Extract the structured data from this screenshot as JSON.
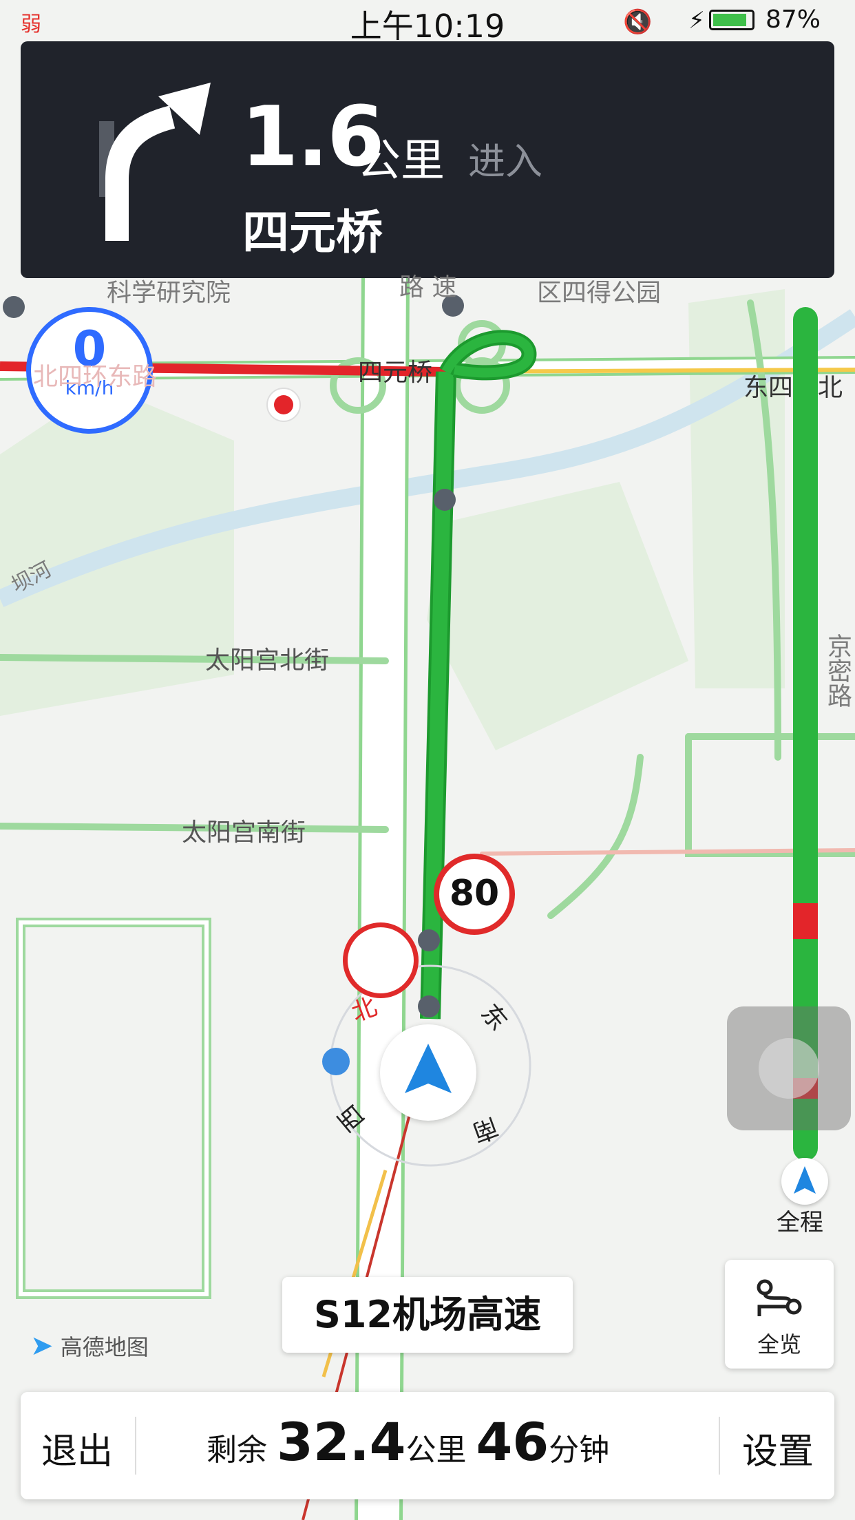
{
  "status_bar": {
    "signal": "弱",
    "time": "上午10:19",
    "battery": "87%"
  },
  "guidance": {
    "turn_icon": "turn-right-arrow-icon",
    "distance_value": "1.6",
    "distance_unit": "公里",
    "action": "进入",
    "road": "四元桥"
  },
  "speedometer": {
    "value": "0",
    "unit": "km/h"
  },
  "map_labels": {
    "kexue": "科学研究院",
    "lu_su": "路 速",
    "park": "区四得公园",
    "beisihuan": "北四环东路",
    "siyuanqiao": "四元桥",
    "dongsihuan": "东四环北",
    "bahe": "坝河",
    "taiyanggong_n": "太阳宫北街",
    "taiyanggong_s": "太阳宫南街",
    "jingmi": "京密路"
  },
  "speed_limit": "80",
  "compass": {
    "north": "北",
    "east": "东",
    "south": "南",
    "west": "西"
  },
  "route_progress": {
    "label": "全程"
  },
  "overview": {
    "label": "全览"
  },
  "current_road": "S12机场高速",
  "logo": "高德地图",
  "bottom_bar": {
    "exit": "退出",
    "remaining_prefix": "剩余",
    "remaining_distance": "32.4",
    "distance_unit": "公里",
    "remaining_time": "46",
    "time_unit": "分钟",
    "settings": "设置"
  },
  "colors": {
    "route_green": "#2bb53f",
    "jam_red": "#e3252a",
    "card_dark": "#20232b",
    "accent_blue": "#2f6bff"
  }
}
